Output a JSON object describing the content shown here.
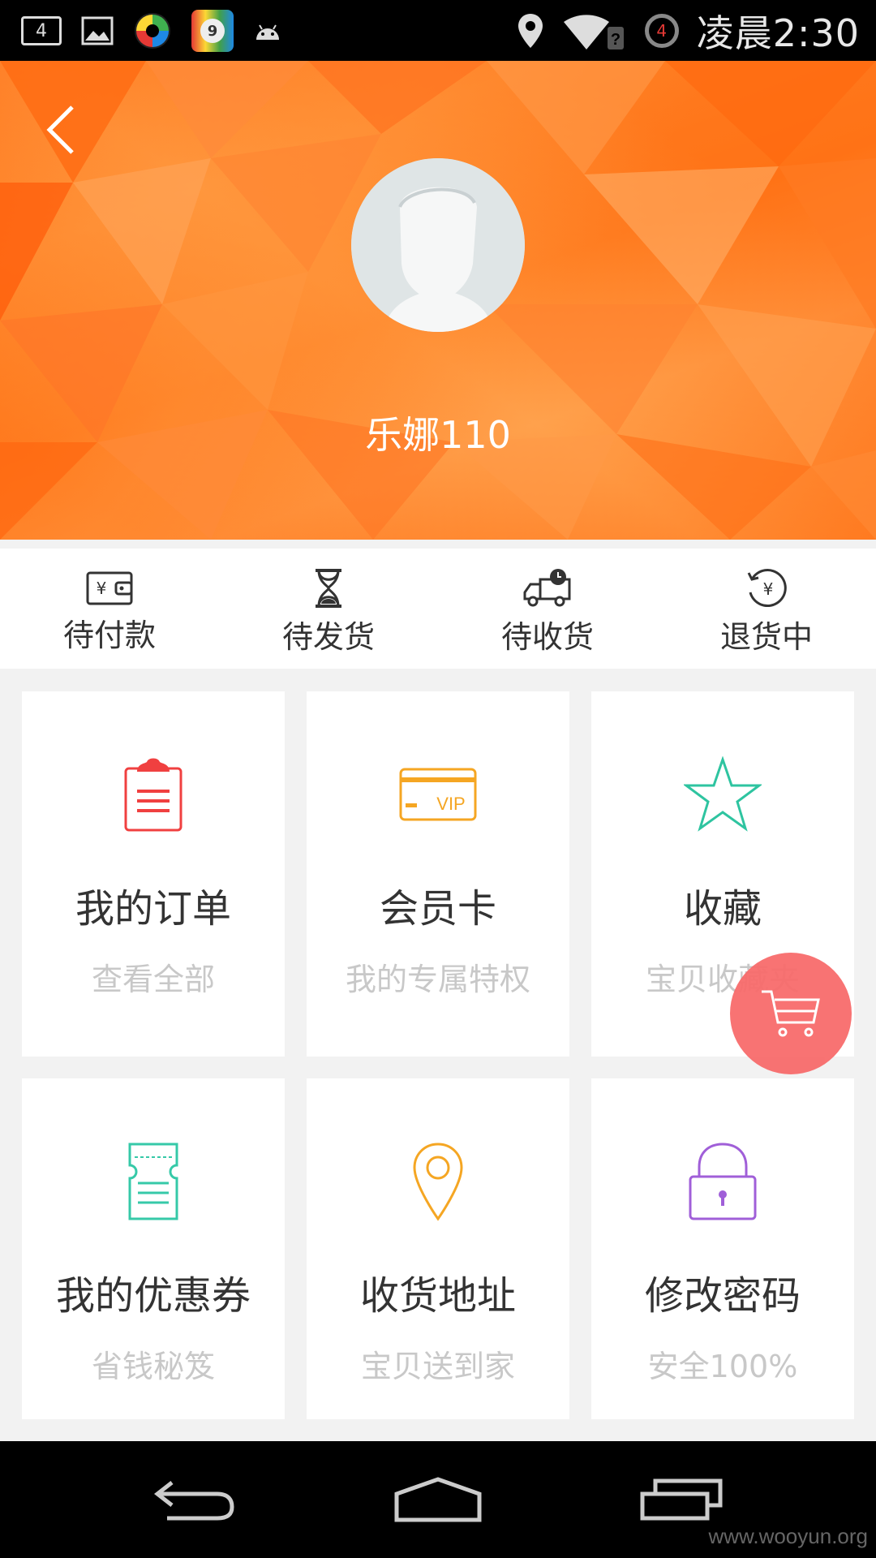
{
  "status_bar": {
    "notification_count": "4",
    "badge_number": "9",
    "alarm_badge": "4",
    "time": "凌晨2:30"
  },
  "profile": {
    "username": "乐娜110"
  },
  "order_bar": [
    {
      "label": "待付款",
      "icon": "wallet-icon"
    },
    {
      "label": "待发货",
      "icon": "hourglass-icon"
    },
    {
      "label": "待收货",
      "icon": "delivery-truck-icon"
    },
    {
      "label": "退货中",
      "icon": "refund-icon"
    }
  ],
  "cards": [
    {
      "title": "我的订单",
      "subtitle": "查看全部",
      "icon": "clipboard-icon",
      "color": "#f04040"
    },
    {
      "title": "会员卡",
      "subtitle": "我的专属特权",
      "icon": "vip-card-icon",
      "color": "#f5a623",
      "icon_text": "VIP"
    },
    {
      "title": "收藏",
      "subtitle": "宝贝收藏夹",
      "icon": "star-icon",
      "color": "#2ec4a0"
    },
    {
      "title": "我的优惠券",
      "subtitle": "省钱秘笈",
      "icon": "coupon-icon",
      "color": "#36c9a8"
    },
    {
      "title": "收货地址",
      "subtitle": "宝贝送到家",
      "icon": "location-pin-icon",
      "color": "#f5a623"
    },
    {
      "title": "修改密码",
      "subtitle": "安全100%",
      "icon": "lock-icon",
      "color": "#a05fd8"
    }
  ],
  "watermark": "www.wooyun.org",
  "colors": {
    "header_orange": "#ff7a1c",
    "cart_fab": "#f86c6c",
    "background": "#f2f2f2"
  }
}
